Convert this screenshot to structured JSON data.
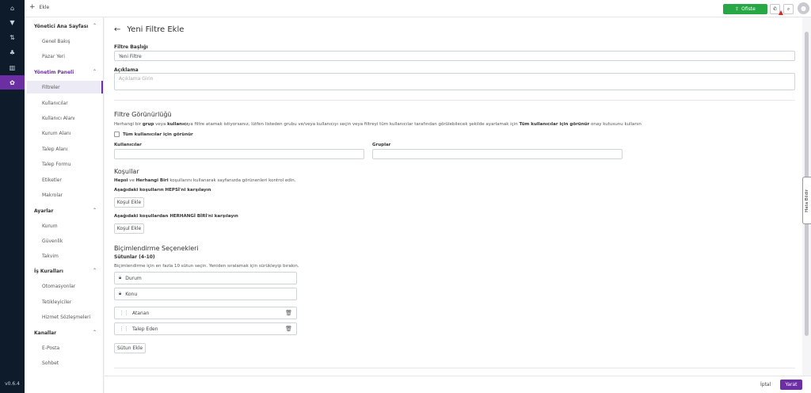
{
  "rail": {
    "items": [
      "home-icon",
      "filter-icon",
      "sort-icon",
      "org-icon",
      "chart-icon",
      "gear-icon"
    ],
    "version": "v0.6.4"
  },
  "topbar": {
    "add_label": "Ekle",
    "status_label": "Ofiste",
    "status_color": "#27a844"
  },
  "sidebar": {
    "sections": [
      {
        "title": "Yönetici Ana Sayfası",
        "items": [
          "Genel Bakış",
          "Pazar Yeri"
        ]
      },
      {
        "title": "Yönetim Paneli",
        "items": [
          "Filtreler",
          "Kullanıcılar",
          "Kullanıcı Alanı",
          "Kurum Alanı",
          "Talep Alanı",
          "Talep Formu",
          "Etiketler",
          "Makrolar"
        ]
      },
      {
        "title": "Ayarlar",
        "items": [
          "Kurum",
          "Güvenlik",
          "Takvim"
        ]
      },
      {
        "title": "İş Kuralları",
        "items": [
          "Otomasyonlar",
          "Tetikleyiciler",
          "Hizmet Sözleşmeleri"
        ]
      },
      {
        "title": "Kanallar",
        "items": [
          "E-Posta",
          "Sohbet"
        ]
      }
    ]
  },
  "page": {
    "title": "Yeni Filtre Ekle",
    "filter_title_label": "Filtre Başlığı",
    "filter_title_value": "Yeni Filtre",
    "description_label": "Açıklama",
    "description_placeholder": "Açıklama Girin",
    "visibility": {
      "heading": "Filtre Görünürlüğü",
      "help_1": "Herhangi bir ",
      "help_b1": "grup",
      "help_2": " veya ",
      "help_b2": "kullanıcı",
      "help_3": "ya filtre atamak istiyorsanız, lütfen listeden grubu ve/veya kullanıcıyı seçin veya filtreyi tüm kullanıcılar tarafından görülebilecek şekilde ayarlamak için ",
      "help_b3": "Tüm kullanıcılar için görünür",
      "help_4": " onay kutusunu kullanın",
      "checkbox_label": "Tüm kullanıcılar için görünür",
      "users_label": "Kullanıcılar",
      "groups_label": "Gruplar"
    },
    "conditions": {
      "heading": "Koşullar",
      "help_b1": "Hepsi",
      "help_1": " ve ",
      "help_b2": "Herhangi Biri",
      "help_2": " koşullarını kullanarak sayfanızda görünenleri kontrol edin.",
      "all_label": "Aşağıdaki koşulların HEPSİ'ni karşılayın",
      "any_label": "Aşağıdaki koşullardan HERHANGİ BİRİ'ni karşılayın",
      "add_button": "Koşul Ekle"
    },
    "formatting": {
      "heading": "Biçimlendirme Seçenekleri",
      "columns_label": "Sütunlar (4-10)",
      "help": "Biçimlendirme için en fazla 10 sütun seçin. Yeniden sıralamak için sürükleyip bırakın.",
      "locked_columns": [
        "Durum",
        "Konu"
      ],
      "columns": [
        "Atanan",
        "Talep Eden"
      ],
      "add_column": "Sütun Ekle"
    }
  },
  "feedback_label": "Hata Bildir",
  "footer": {
    "cancel": "İptal",
    "create": "Yarat",
    "accent": "#6b2fa3"
  }
}
